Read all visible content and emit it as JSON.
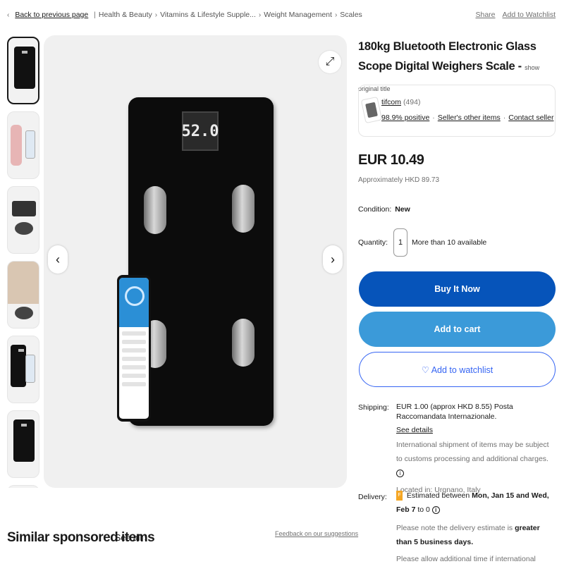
{
  "breadcrumb": {
    "back_label": "Back to previous page",
    "items": [
      "Health & Beauty",
      "Vitamins & Lifestyle Supple...",
      "Weight Management",
      "Scales"
    ]
  },
  "top_actions": {
    "share": "Share",
    "watchlist": "Add to Watchlist"
  },
  "gallery": {
    "thumbnail_count": 7,
    "scale_display": "52.0",
    "expand_icon": "expand-arrows-icon"
  },
  "product": {
    "title": "180kg Bluetooth Electronic Glass Scope Digital Weighers Scale -",
    "show_original": "show original title",
    "price": "EUR 10.49",
    "approx_price": "Approximately HKD 89.73",
    "condition_label": "Condition:",
    "condition_value": "New",
    "quantity_label": "Quantity:",
    "quantity_value": "1",
    "availability": "More than 10 available"
  },
  "seller": {
    "name": "tifcom",
    "count": "(494)",
    "positive": "98.9% positive",
    "other_items": "Seller's other items",
    "contact": "Contact seller"
  },
  "buttons": {
    "buy_now": "Buy It Now",
    "add_to_cart": "Add to cart",
    "add_to_watchlist": "♡ Add to watchlist"
  },
  "shipping": {
    "label": "Shipping:",
    "main": "EUR 1.00 (approx HKD 8.55) Posta Raccomandata Internazionale.",
    "see_details": "See details",
    "note": "International shipment of items may be subject to customs processing and additional charges.",
    "location": "Located in: Urgnano, Italy"
  },
  "delivery": {
    "label": "Delivery:",
    "estimate_prefix": "Estimated between",
    "estimate_dates": "Mon, Jan 15 and Wed, Feb 7",
    "estimate_suffix": "to 0",
    "note1_prefix": "Please note the delivery estimate is",
    "note1_bold": "greater than 5 business days.",
    "note2": "Please allow additional time if international delivery is subject to customs processing."
  },
  "similar": {
    "heading": "Similar sponsored items",
    "see_all": "See all ›",
    "feedback": "Feedback on our suggestions"
  }
}
